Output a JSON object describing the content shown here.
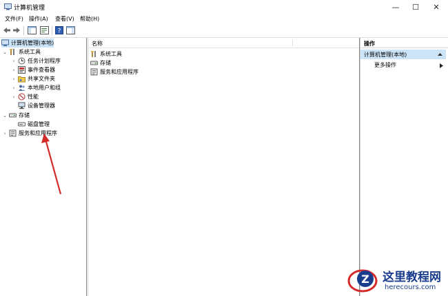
{
  "window": {
    "title": "计算机管理",
    "minimize_glyph": "—",
    "maximize_glyph": "☐",
    "close_glyph": "✕"
  },
  "menu": [
    "文件(F)",
    "操作(A)",
    "查看(V)",
    "帮助(H)"
  ],
  "toolbar": [
    "back-icon",
    "forward-icon",
    "show-hide-console-tree-icon",
    "properties-icon",
    "help-icon",
    "show-action-pane-icon"
  ],
  "tree": {
    "root": "计算机管理(本地)",
    "system_tools": {
      "label": "系统工具",
      "children": [
        "任务计划程序",
        "事件查看器",
        "共享文件夹",
        "本地用户和组",
        "性能",
        "设备管理器"
      ]
    },
    "storage": {
      "label": "存储",
      "children": [
        "磁盘管理"
      ]
    },
    "services": "服务和应用程序"
  },
  "list": {
    "column_name": "名称",
    "items": [
      "系统工具",
      "存储",
      "服务和应用程序"
    ]
  },
  "actions": {
    "header": "操作",
    "selected": "计算机管理(本地)",
    "more": "更多操作"
  },
  "watermark": {
    "logo_letter": "Z",
    "title": "这里教程网",
    "url": "herecours.com"
  },
  "colors": {
    "selection": "#cce4f7",
    "arrow": "#d42a2a",
    "watermark_blue": "#1a3c8c"
  }
}
